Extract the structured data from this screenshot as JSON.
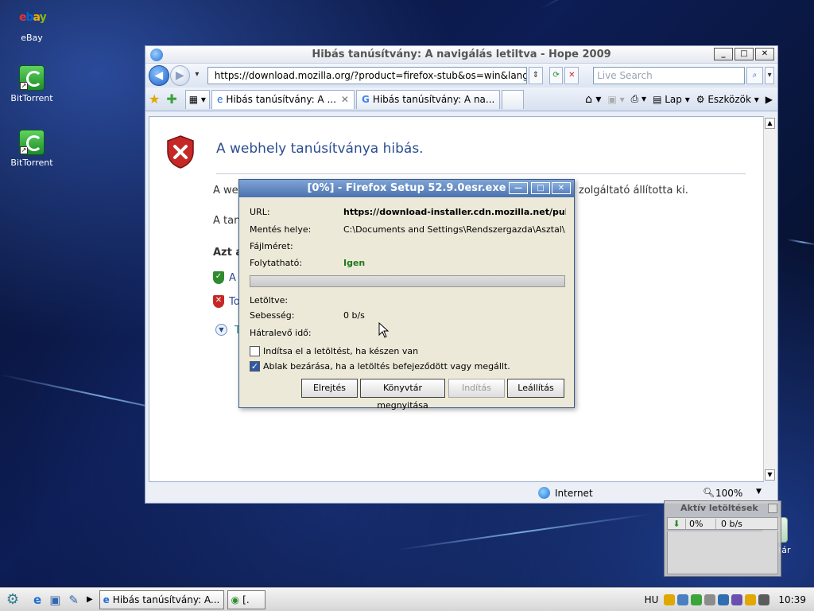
{
  "desktop": {
    "icons": [
      {
        "label": "eBay"
      },
      {
        "label": "BitTorrent"
      },
      {
        "label": "BitTorrent"
      },
      {
        "label": "Lomtár"
      }
    ]
  },
  "browser": {
    "title": "Hibás tanúsítvány: A navigálás letiltva - Hope 2009",
    "url": "https://download.mozilla.org/?product=firefox-stub&os=win&lang",
    "search_placeholder": "Live Search",
    "tabs": [
      {
        "label": "Hibás tanúsítvány: A ..."
      },
      {
        "label": "Hibás tanúsítvány: A na..."
      }
    ],
    "toolbar": {
      "page_label": "Lap",
      "tools_label": "Eszközök"
    },
    "content": {
      "heading": "A webhely tanúsítványa hibás.",
      "line1_start": "A web",
      "line1_end": "zolgáltató állította ki.",
      "line2_start": "A tan",
      "section_title_start": "Azt a",
      "opt1_start": "A",
      "opt2_start": "To",
      "opt3_start": "T"
    },
    "status": {
      "zone": "Internet",
      "zoom": "100%"
    }
  },
  "download_dialog": {
    "title": "[0%] - Firefox Setup 52.9.0esr.exe",
    "labels": {
      "url": "URL:",
      "save_to": "Mentés helye:",
      "filesize": "Fájlméret:",
      "resumable": "Folytatható:",
      "downloaded": "Letöltve:",
      "speed": "Sebesség:",
      "remaining": "Hátralevő idő:"
    },
    "values": {
      "url": "https://download-installer.cdn.mozilla.net/pub/firefox",
      "save_to": "C:\\Documents and Settings\\Rendszergazda\\Asztal\\",
      "resumable": "Igen",
      "speed": "0 b/s"
    },
    "progress_percent": 0,
    "checkboxes": [
      {
        "label": "Indítsa el a letöltést, ha készen van",
        "checked": false
      },
      {
        "label": "Ablak bezárása, ha a letöltés befejeződött vagy megállt.",
        "checked": true
      }
    ],
    "buttons": {
      "hide": "Elrejtés",
      "open_folder": "Könyvtár megnyitása",
      "start": "Indítás",
      "stop": "Leállítás"
    }
  },
  "downloads_widget": {
    "title": "Aktív letöltések",
    "percent": "0%",
    "speed": "0 b/s"
  },
  "taskbar": {
    "tasks": [
      {
        "label": "Hibás tanúsítvány: A..."
      },
      {
        "label": "[."
      }
    ],
    "language": "HU",
    "clock": "10:39"
  },
  "colors": {
    "accent": "#2c4e8e",
    "resumable_green": "#1a7a1a",
    "shield_red": "#c62828"
  }
}
